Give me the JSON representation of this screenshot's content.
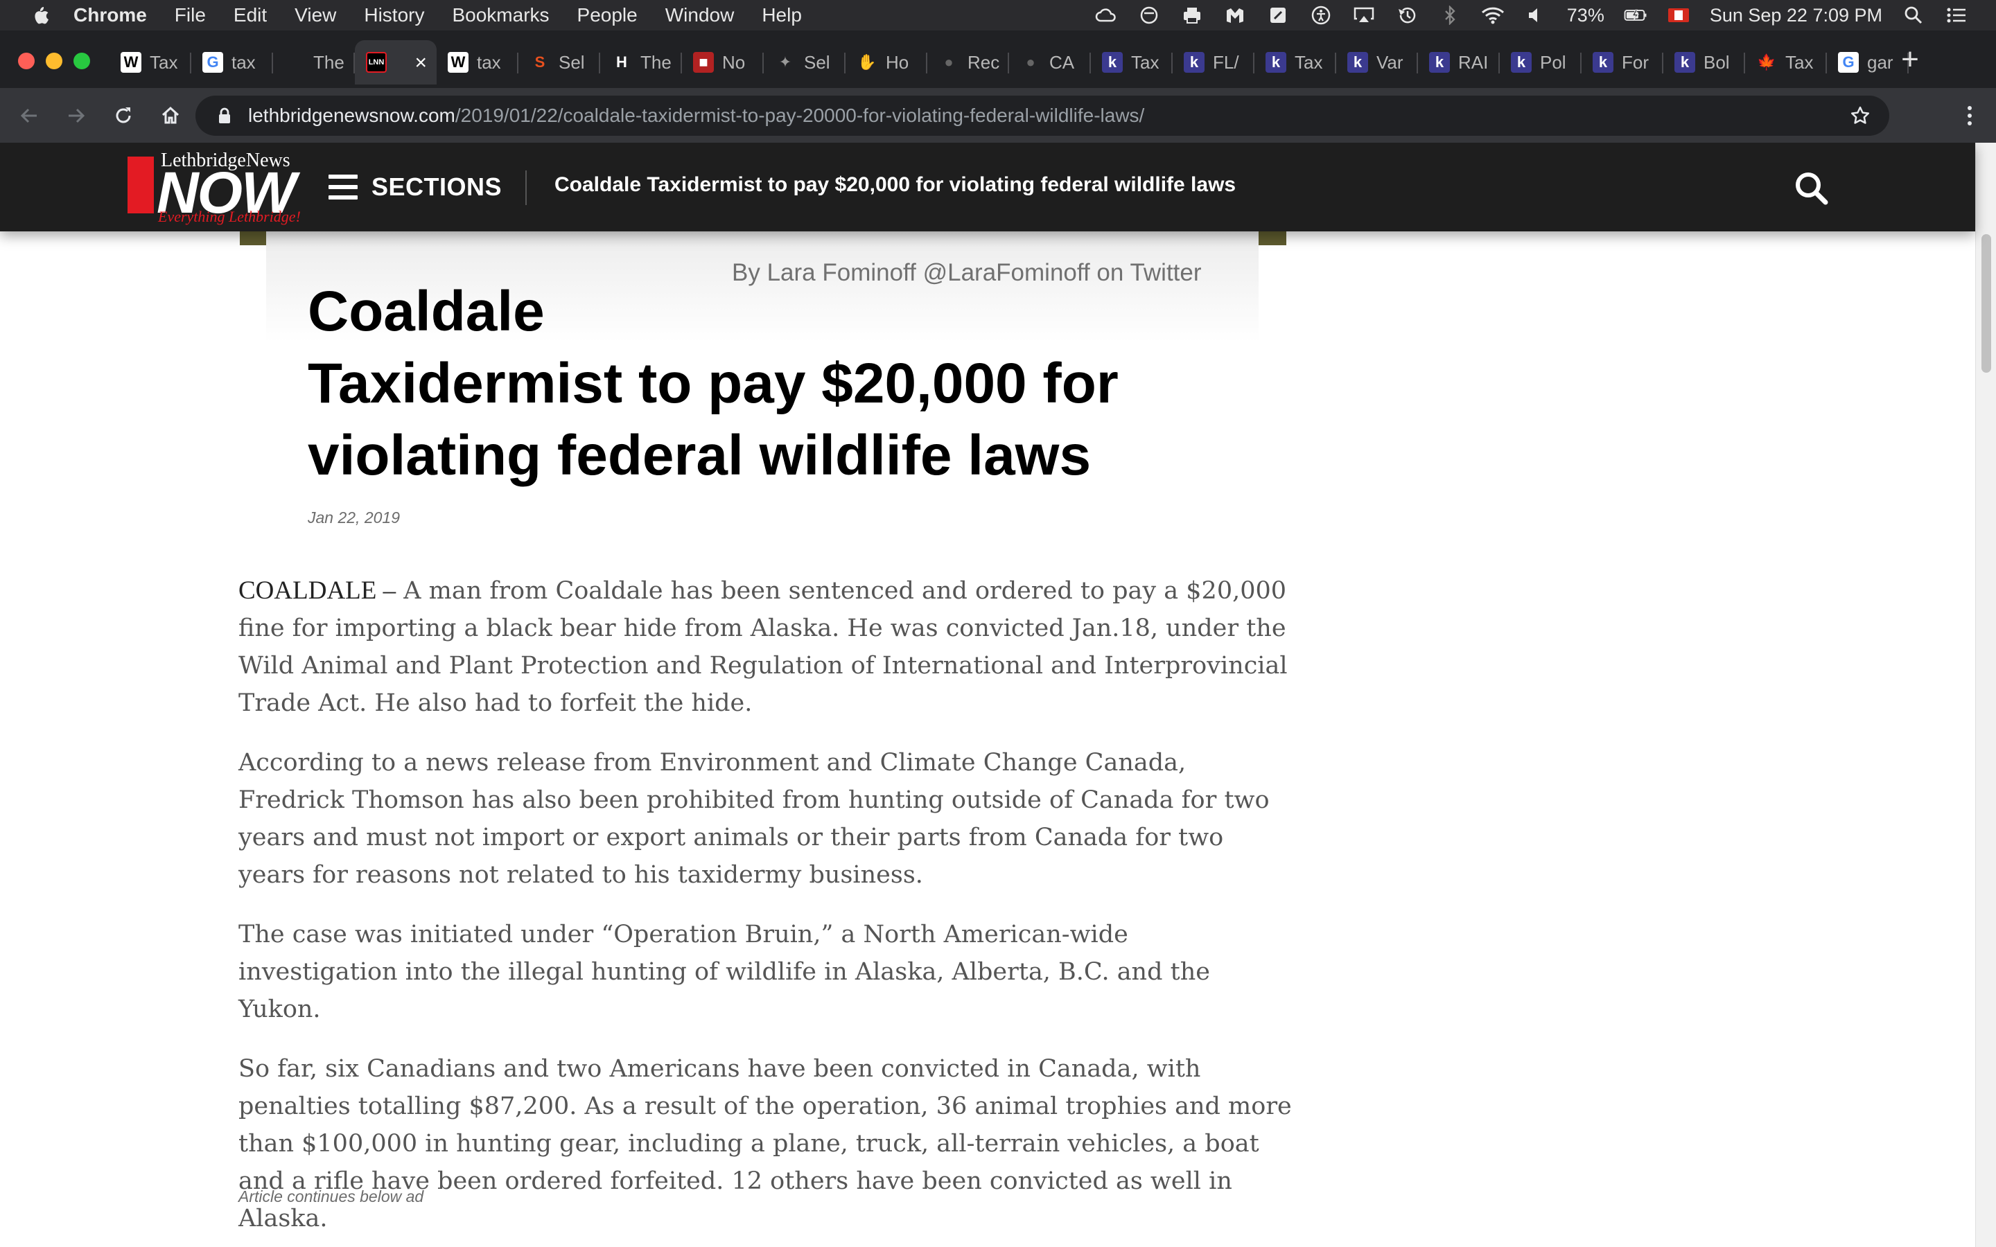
{
  "menubar": {
    "app": "Chrome",
    "items": [
      "File",
      "Edit",
      "View",
      "History",
      "Bookmarks",
      "People",
      "Window",
      "Help"
    ],
    "battery": "73%",
    "datetime": "Sun Sep 22  7:09 PM"
  },
  "tabs": [
    {
      "label": "Tax",
      "icon": "W",
      "color": "#ffffff",
      "bg": "#ffffff",
      "fg": "#000000"
    },
    {
      "label": "tax",
      "icon": "G",
      "color": "#4285f4",
      "bg": "#ffffff",
      "fg": "#4285f4"
    },
    {
      "label": "The",
      "icon": "",
      "color": "",
      "bg": "transparent",
      "fg": "#b8b8b8"
    },
    {
      "label": "",
      "icon": "LNN",
      "color": "#e31b23",
      "bg": "#000000",
      "fg": "#ffffff",
      "active": true
    },
    {
      "label": "tax",
      "icon": "W",
      "color": "#ffffff",
      "bg": "#ffffff",
      "fg": "#000000"
    },
    {
      "label": "Sel",
      "icon": "S",
      "color": "#e8501e",
      "bg": "transparent",
      "fg": "#e8501e"
    },
    {
      "label": "The",
      "icon": "H",
      "color": "#ffffff",
      "bg": "transparent",
      "fg": "#ffffff"
    },
    {
      "label": "No",
      "icon": "■",
      "color": "#b22222",
      "bg": "#b22222",
      "fg": "#ffffff"
    },
    {
      "label": "Sel",
      "icon": "✦",
      "color": "#999999",
      "bg": "transparent",
      "fg": "#999999"
    },
    {
      "label": "Ho",
      "icon": "✋",
      "color": "#ffffff",
      "bg": "transparent",
      "fg": "#ffffff"
    },
    {
      "label": "Rec",
      "icon": "●",
      "color": "#666666",
      "bg": "transparent",
      "fg": "#666666"
    },
    {
      "label": "CA",
      "icon": "●",
      "color": "#666666",
      "bg": "transparent",
      "fg": "#666666"
    },
    {
      "label": "Tax",
      "icon": "k",
      "color": "#3b3a8f",
      "bg": "#3b3a8f",
      "fg": "#ffffff"
    },
    {
      "label": "FL/",
      "icon": "k",
      "color": "#3b3a8f",
      "bg": "#3b3a8f",
      "fg": "#ffffff"
    },
    {
      "label": "Tax",
      "icon": "k",
      "color": "#3b3a8f",
      "bg": "#3b3a8f",
      "fg": "#ffffff"
    },
    {
      "label": "Var",
      "icon": "k",
      "color": "#3b3a8f",
      "bg": "#3b3a8f",
      "fg": "#ffffff"
    },
    {
      "label": "RAI",
      "icon": "k",
      "color": "#3b3a8f",
      "bg": "#3b3a8f",
      "fg": "#ffffff"
    },
    {
      "label": "Pol",
      "icon": "k",
      "color": "#3b3a8f",
      "bg": "#3b3a8f",
      "fg": "#ffffff"
    },
    {
      "label": "For",
      "icon": "k",
      "color": "#3b3a8f",
      "bg": "#3b3a8f",
      "fg": "#ffffff"
    },
    {
      "label": "Bol",
      "icon": "k",
      "color": "#3b3a8f",
      "bg": "#3b3a8f",
      "fg": "#ffffff"
    },
    {
      "label": "Tax",
      "icon": "🍁",
      "color": "#d52b1e",
      "bg": "transparent",
      "fg": "#d52b1e"
    },
    {
      "label": "gar",
      "icon": "G",
      "color": "#4285f4",
      "bg": "#ffffff",
      "fg": "#4285f4"
    }
  ],
  "address": {
    "domain": "lethbridgenewsnow.com",
    "path": "/2019/01/22/coaldale-taxidermist-to-pay-20000-for-violating-federal-wildlife-laws/"
  },
  "site": {
    "logo_top": "LethbridgeNews",
    "logo_main": "NOW",
    "logo_tag": "Everything Lethbridge!",
    "sections_label": "SECTIONS",
    "header_title": "Coaldale Taxidermist to pay $20,000 for violating federal wildlife laws"
  },
  "article": {
    "byline": "By Lara Fominoff @LaraFominoff on Twitter",
    "headline_lines": [
      "Coaldale",
      "Taxidermist to pay $20,000 for",
      "violating federal wildlife laws"
    ],
    "date": "Jan 22, 2019",
    "dateline": "COALDALE –",
    "p1": " A man from Coaldale has been sentenced and ordered to pay a $20,000 fine for importing a black bear hide from Alaska. He was convicted Jan.18, under the Wild Animal and Plant Protection and Regulation of International and Interprovincial Trade Act. He also had to forfeit the hide.",
    "p2": "According to a news release from Environment and Climate Change Canada, Fredrick Thomson has also been prohibited from hunting outside of Canada for two years and must not import or export animals or their parts from Canada for two years for reasons not related to his taxidermy business.",
    "p3": "The case was initiated under “Operation Bruin,” a North American-wide investigation into the illegal hunting of wildlife in Alaska, Alberta, B.C. and the Yukon.",
    "p4": "So far, six Canadians and two Americans have been convicted in Canada, with penalties totalling $87,200. As a result of the operation, 36 animal trophies and more than $100,000 in hunting gear, including a plane, truck, all-terrain vehicles, a boat and a rifle have been ordered forfeited. 12 others have been convicted as well in Alaska.",
    "ad_note": "Article continues below ad"
  },
  "colors": {
    "brand_red": "#e31b23",
    "header_bg": "#1e1e1e",
    "chrome_dark": "#202124"
  }
}
